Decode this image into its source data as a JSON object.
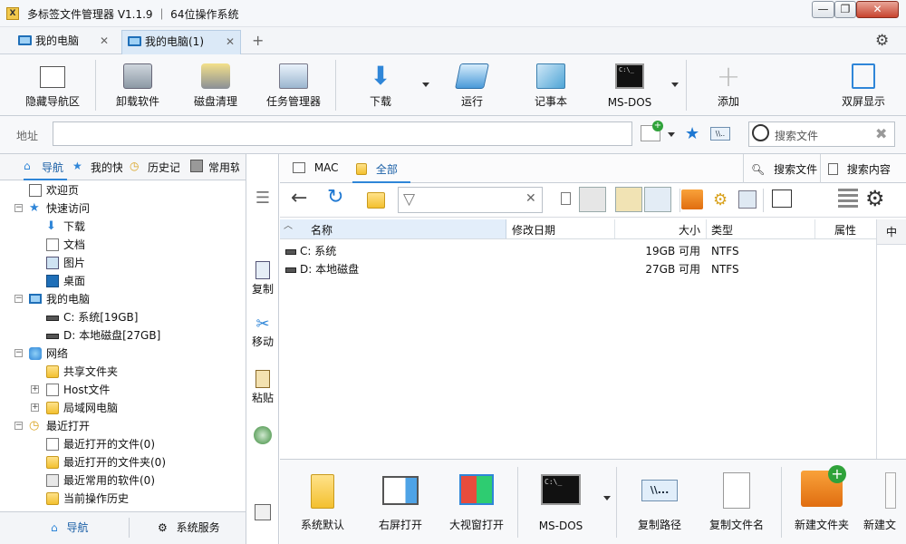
{
  "window": {
    "title": "多标签文件管理器 V1.1.9 ｜ 64位操作系统",
    "minimize": "—",
    "restore": "❐",
    "close": "✕"
  },
  "tabs": [
    {
      "label": "我的电脑"
    },
    {
      "label": "我的电脑(1)"
    }
  ],
  "new_tab": "+",
  "toolbar": {
    "buttons": [
      "隐藏导航区",
      "卸载软件",
      "磁盘清理",
      "任务管理器",
      "下载",
      "运行",
      "记事本",
      "MS-DOS",
      "添加",
      "双屏显示"
    ]
  },
  "address": {
    "label": "地址",
    "value": "",
    "search_placeholder": "搜索文件"
  },
  "left_tabs": [
    "导航",
    "我的快",
    "历史记",
    "常用软"
  ],
  "tree": [
    {
      "label": "欢迎页"
    },
    {
      "label": "快速访问"
    },
    {
      "label": "下载"
    },
    {
      "label": "文档"
    },
    {
      "label": "图片"
    },
    {
      "label": "桌面"
    },
    {
      "label": "我的电脑"
    },
    {
      "label": "C: 系统[19GB]"
    },
    {
      "label": "D: 本地磁盘[27GB]"
    },
    {
      "label": "网络"
    },
    {
      "label": "共享文件夹"
    },
    {
      "label": "Host文件"
    },
    {
      "label": "局域网电脑"
    },
    {
      "label": "最近打开"
    },
    {
      "label": "最近打开的文件(0)"
    },
    {
      "label": "最近打开的文件夹(0)"
    },
    {
      "label": "最近常用的软件(0)"
    },
    {
      "label": "当前操作历史"
    }
  ],
  "left_bottom": {
    "nav": "导航",
    "service": "系统服务"
  },
  "mid_strip": {
    "copy": "复制",
    "move": "移动",
    "paste": "粘贴"
  },
  "right_tabs": {
    "mac": "MAC",
    "all": "全部",
    "search_file": "搜索文件",
    "search_content": "搜索内容"
  },
  "columns": {
    "name": "名称",
    "modified": "修改日期",
    "size": "大小",
    "type": "类型",
    "attr": "属性",
    "preview": "中"
  },
  "files": [
    {
      "name": "C: 系统",
      "size": "19GB 可用",
      "type": "NTFS"
    },
    {
      "name": "D: 本地磁盘",
      "size": "27GB 可用",
      "type": "NTFS"
    }
  ],
  "bottom_buttons": [
    "系统默认",
    "右屏打开",
    "大视窗打开",
    "MS-DOS",
    "复制路径",
    "复制文件名",
    "新建文件夹",
    "新建文"
  ]
}
